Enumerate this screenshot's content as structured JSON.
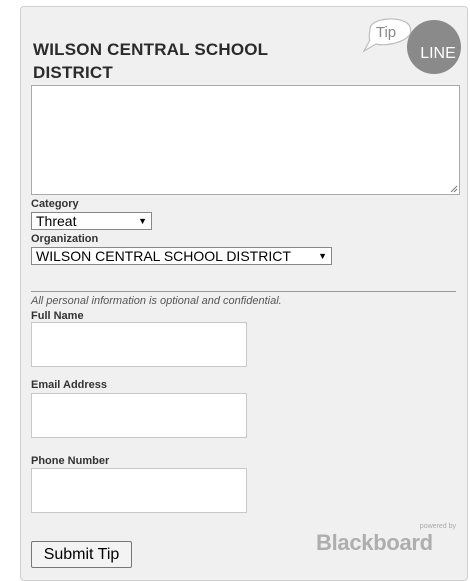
{
  "form": {
    "title": "WILSON CENTRAL SCHOOL DISTRICT",
    "description_value": "",
    "category_label": "Category",
    "category_selected": "Threat",
    "organization_label": "Organization",
    "organization_selected": "WILSON CENTRAL SCHOOL DISTRICT",
    "privacy_note": "All personal information is optional and confidential.",
    "full_name_label": "Full Name",
    "full_name_value": "",
    "email_label": "Email Address",
    "email_value": "",
    "phone_label": "Phone Number",
    "phone_value": "",
    "submit_label": "Submit Tip"
  },
  "logo": {
    "tip": "Tip",
    "line": "LINE"
  },
  "branding": {
    "powered_by": "powered by",
    "brand": "Blackboard"
  },
  "colors": {
    "panel": "#f0f0f0",
    "logo_bubble": "#8a8a8a",
    "brand_gray": "#aeaeae"
  }
}
